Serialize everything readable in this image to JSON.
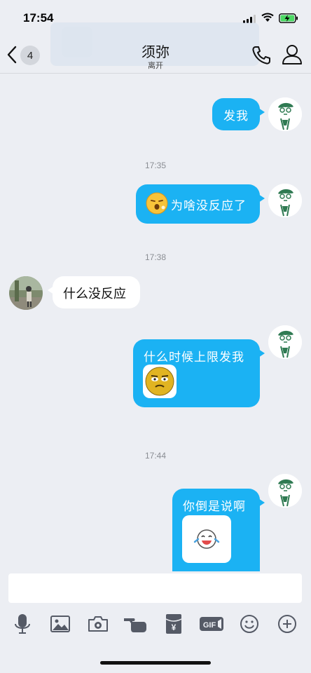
{
  "status": {
    "time": "17:54"
  },
  "header": {
    "unread_count": "4",
    "title": "须弥",
    "subtitle": "离开"
  },
  "messages": {
    "m1": {
      "text": "发我"
    },
    "ts1": "17:35",
    "m2": {
      "text": "为啥没反应了"
    },
    "ts2": "17:38",
    "m3": {
      "text": "什么没反应"
    },
    "m4": {
      "text": "什么时候上限发我"
    },
    "ts3": "17:44",
    "m5": {
      "text": "你倒是说啊"
    }
  },
  "colors": {
    "bubble_out": "#1bb2f3",
    "background": "#eceef3",
    "bubble_in": "#ffffff"
  },
  "toolbar_icons": [
    "mic-icon",
    "image-icon",
    "camera-icon",
    "poke-hand-icon",
    "red-packet-icon",
    "gif-icon",
    "emoji-icon",
    "plus-icon"
  ],
  "toolbar": {
    "red_packet_symbol": "¥",
    "gif_label": "GIF"
  }
}
